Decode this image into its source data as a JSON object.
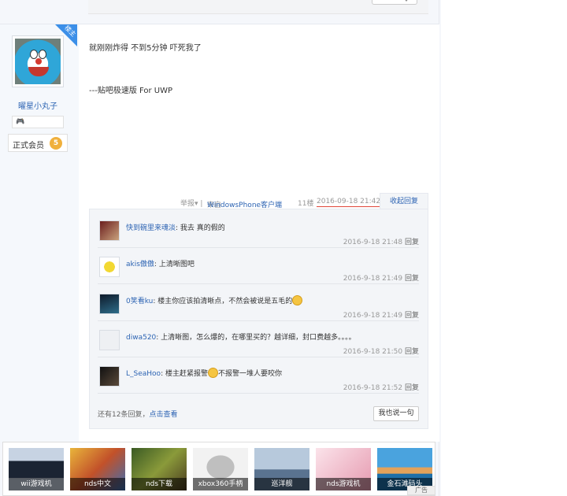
{
  "post": {
    "username": "曜星小丸子",
    "badge": "楼主",
    "member_label": "正式会员",
    "member_level": "5",
    "content_line1": "就刚刚炸得 不到5分钟 吓死我了",
    "content_line2": "---贴吧极速版 For UWP",
    "meta_report": "举报▾ |",
    "meta_source_prefix": "来自",
    "meta_source_link": "WindowsPhone客户端",
    "meta_floor": "11楼",
    "meta_time": "2016-09-18 21:42",
    "collapse_label": "收起回复"
  },
  "comments": [
    {
      "user": "快到碗里来魂淡",
      "text": ": 我去 真的假的",
      "time": "2016-9-18 21:48",
      "reply": "回复",
      "emoji": false,
      "after": ""
    },
    {
      "user": "akis傲傲",
      "text": ": 上清晰图吧",
      "time": "2016-9-18 21:49",
      "reply": "回复",
      "emoji": false,
      "after": ""
    },
    {
      "user": "0笑看ku",
      "text": ": 楼主你应该拍清晰点，不然会被说是五毛的",
      "time": "2016-9-18 21:49",
      "reply": "回复",
      "emoji": true,
      "after": ""
    },
    {
      "user": "diwa520",
      "text": ": 上清晰图，怎么爆的，在哪里买的？越详细，封口费越多。。。。",
      "time": "2016-9-18 21:50",
      "reply": "回复",
      "emoji": false,
      "after": ""
    },
    {
      "user": "L_SeaHoo",
      "text": ": 楼主赶紧报警",
      "time": "2016-9-18 21:52",
      "reply": "回复",
      "emoji": true,
      "after": "不报警一堆人要咬你"
    }
  ],
  "comments_footer": {
    "more_prefix": "还有12条回复，",
    "more_link": "点击查看",
    "say_button": "我也说一句"
  },
  "ads": [
    {
      "label": "wii游戏机",
      "color": "#1f3b6e"
    },
    {
      "label": "nds中文",
      "color": "#c2512a"
    },
    {
      "label": "nds下载",
      "color": "#5e6b2d"
    },
    {
      "label": "xbox360手柄",
      "color": "#d9d9d9"
    },
    {
      "label": "巡洋舰",
      "color": "#7c95b0"
    },
    {
      "label": "nds游戏机",
      "color": "#e69ab0"
    },
    {
      "label": "金石滩码头",
      "color": "#2f8fcf"
    }
  ],
  "ad_tag": "广告",
  "colors": {
    "link": "#2d64b3",
    "badge": "#3c8fe8",
    "time_underline": "#e0463a"
  }
}
